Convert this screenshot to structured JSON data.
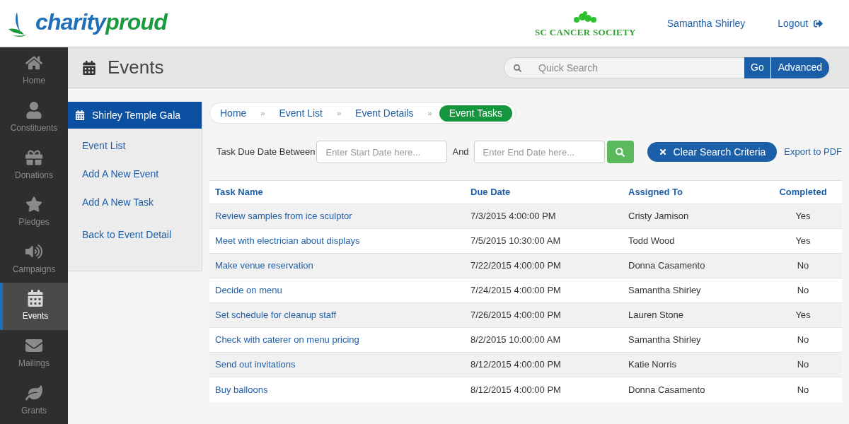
{
  "header": {
    "logo": {
      "part_1": "charity",
      "part_2": "proud"
    },
    "org": "SC CANCER SOCIETY",
    "user": "Samantha Shirley",
    "logout": "Logout"
  },
  "nav": [
    {
      "label": "Home",
      "selected": false
    },
    {
      "label": "Constituents",
      "selected": false
    },
    {
      "label": "Donations",
      "selected": false
    },
    {
      "label": "Pledges",
      "selected": false
    },
    {
      "label": "Campaigns",
      "selected": false
    },
    {
      "label": "Events",
      "selected": true
    },
    {
      "label": "Mailings",
      "selected": false
    },
    {
      "label": "Grants",
      "selected": false
    }
  ],
  "page_title": "Events",
  "search": {
    "placeholder": "Quick Search",
    "go": "Go",
    "advanced": "Advanced"
  },
  "side_panel": {
    "title": "Shirley Temple Gala",
    "links": [
      "Event List",
      "Add A New Event",
      "Add A New Task",
      "Back to Event Detail"
    ]
  },
  "breadcrumb": [
    {
      "label": "Home",
      "selected": false
    },
    {
      "separator": "»",
      "label": "Event List",
      "selected": false
    },
    {
      "separator": "»",
      "label": "Event Details",
      "selected": false
    },
    {
      "separator": "»",
      "label": "Event Tasks",
      "selected": true
    }
  ],
  "filter": {
    "label": "Task Due Date Between",
    "start_placeholder": "Enter Start Date here...",
    "and": "And",
    "end_placeholder": "Enter End Date here...",
    "clear": "Clear Search Criteria",
    "export": "Export to PDF"
  },
  "table": {
    "columns": [
      "Task Name",
      "Due Date",
      "Assigned To",
      "Completed"
    ],
    "rows": [
      [
        "Review samples from ice sculptor",
        "7/3/2015 4:00:00 PM",
        "Cristy Jamison",
        "Yes"
      ],
      [
        "Meet with electrician about displays",
        "7/5/2015 10:30:00 AM",
        "Todd Wood",
        "Yes"
      ],
      [
        "Make venue reservation",
        "7/22/2015 4:00:00 PM",
        "Donna Casamento",
        "No"
      ],
      [
        "Decide on menu",
        "7/24/2015 4:00:00 PM",
        "Samantha Shirley",
        "No"
      ],
      [
        "Set schedule for cleanup staff",
        "7/26/2015 4:00:00 PM",
        "Lauren Stone",
        "Yes"
      ],
      [
        "Check with caterer on menu pricing",
        "8/2/2015 10:00:00 AM",
        "Samantha Shirley",
        "No"
      ],
      [
        "Send out invitations",
        "8/12/2015 4:00:00 PM",
        "Katie Norris",
        "No"
      ],
      [
        "Buy balloons",
        "8/12/2015 4:00:00 PM",
        "Donna Casamento",
        "No"
      ]
    ]
  }
}
